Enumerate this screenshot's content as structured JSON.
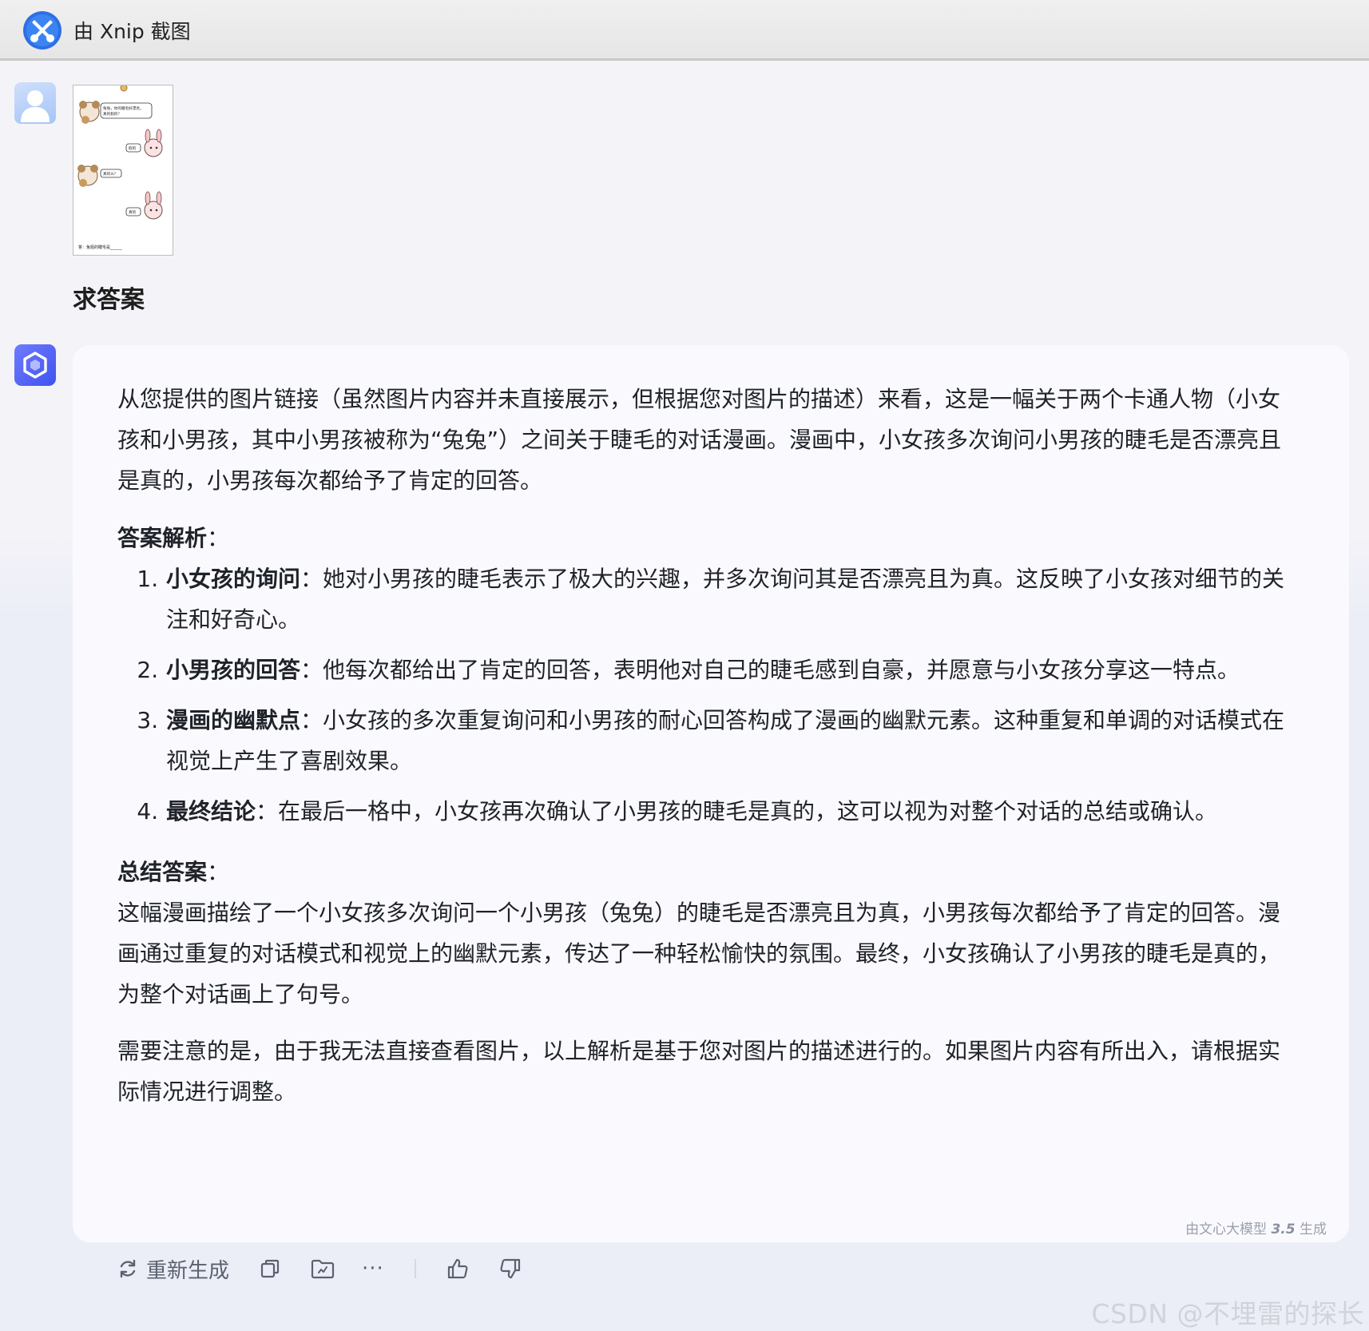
{
  "window": {
    "title": "由 Xnip 截图"
  },
  "user_message": {
    "question": "求答案",
    "comic": {
      "bubble_1": "兔兔，你的睫毛好漂亮，真的假的？",
      "bubble_2": "假的",
      "bubble_3": "真的么？",
      "bubble_4": "真的",
      "caption": "答：兔姐的睫毛是______"
    }
  },
  "answer": {
    "intro": "从您提供的图片链接（虽然图片内容并未直接展示，但根据您对图片的描述）来看，这是一幅关于两个卡通人物（小女孩和小男孩，其中小男孩被称为“兔兔”）之间关于睫毛的对话漫画。漫画中，小女孩多次询问小男孩的睫毛是否漂亮且是真的，小男孩每次都给予了肯定的回答。",
    "analysis_heading": "答案解析",
    "colon": "：",
    "items": [
      {
        "title": "小女孩的询问",
        "text": "她对小男孩的睫毛表示了极大的兴趣，并多次询问其是否漂亮且为真。这反映了小女孩对细节的关注和好奇心。"
      },
      {
        "title": "小男孩的回答",
        "text": "他每次都给出了肯定的回答，表明他对自己的睫毛感到自豪，并愿意与小女孩分享这一特点。"
      },
      {
        "title": "漫画的幽默点",
        "text": "小女孩的多次重复询问和小男孩的耐心回答构成了漫画的幽默元素。这种重复和单调的对话模式在视觉上产生了喜剧效果。"
      },
      {
        "title": "最终结论",
        "text": "在最后一格中，小女孩再次确认了小男孩的睫毛是真的，这可以视为对整个对话的总结或确认。"
      }
    ],
    "summary_heading": "总结答案",
    "summary": "这幅漫画描绘了一个小女孩多次询问一个小男孩（兔兔）的睫毛是否漂亮且为真，小男孩每次都给予了肯定的回答。漫画通过重复的对话模式和视觉上的幽默元素，传达了一种轻松愉快的氛围。最终，小女孩确认了小男孩的睫毛是真的，为整个对话画上了句号。",
    "note": "需要注意的是，由于我无法直接查看图片，以上解析是基于您对图片的描述进行的。如果图片内容有所出入，请根据实际情况进行调整。",
    "badge_prefix": "由文心大模型",
    "badge_version": "3.5",
    "badge_suffix": "生成"
  },
  "actions": {
    "regenerate": "重新生成",
    "more": "···"
  },
  "watermark": "CSDN @不埋雷的探长",
  "colors": {
    "accent": "#4a5cf0",
    "page_bg": "#eff0f7",
    "card_bg": "#fafafe"
  }
}
